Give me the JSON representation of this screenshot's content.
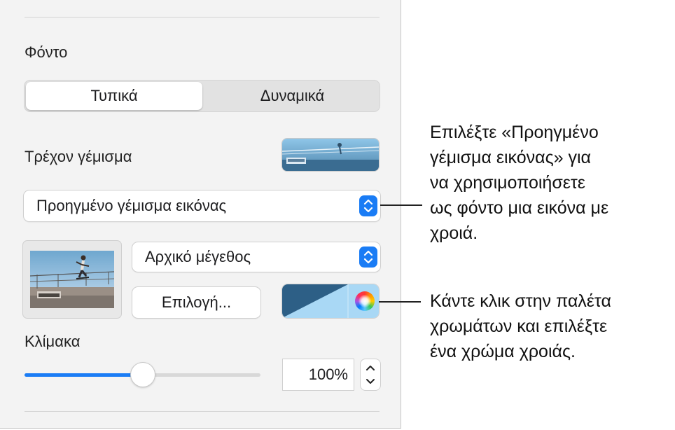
{
  "sidebar": {
    "section_title": "Φόντο",
    "segmented": {
      "active": "Τυπικά",
      "inactive": "Δυναμικά"
    },
    "current_fill_label": "Τρέχον γέμισμα",
    "fill_type_popup": {
      "value": "Προηγμένο γέμισμα εικόνας",
      "icon": "updown-chevron-icon"
    },
    "size_popup": {
      "value": "Αρχικό μέγεθος",
      "icon": "updown-chevron-icon"
    },
    "choose_button_label": "Επιλογή...",
    "tint_colors": {
      "dark": "#2d5f86",
      "light": "#a9d8f5"
    },
    "scale_label": "Κλίμακα",
    "scale_slider_fraction": 0.5,
    "scale_value": "100%",
    "accent_color": "#1a7cf5"
  },
  "callouts": {
    "advanced_fill": "Επιλέξτε «Προηγμένο\nγέμισμα εικόνας» για\nνα χρησιμοποιήσετε\nως φόντο μια εικόνα με\nχροιά.",
    "color_picker": "Κάντε κλικ στην παλέτα\nχρωμάτων και επιλέξτε\nένα χρώμα χροιάς."
  }
}
